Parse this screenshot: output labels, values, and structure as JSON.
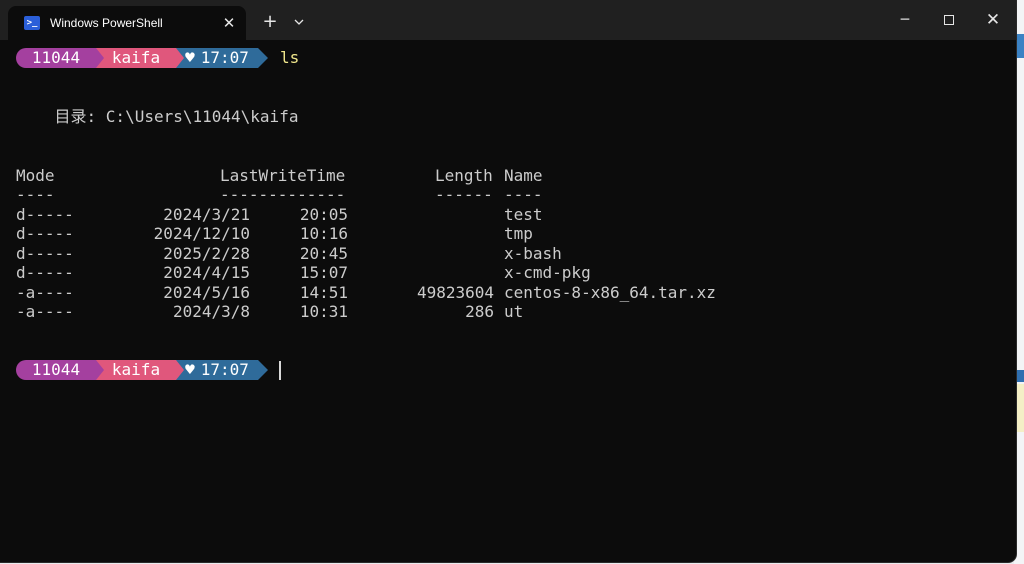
{
  "window": {
    "tab_title": "Windows PowerShell",
    "tab_icon": "powershell-icon",
    "new_tab_label": "+",
    "controls": [
      "minimize",
      "maximize",
      "close"
    ]
  },
  "prompt1": {
    "user": "11044",
    "dir": "kaifa",
    "heart": "♥",
    "time": "17:07",
    "command": "ls"
  },
  "directory_line": "    目录: C:\\Users\\11044\\kaifa",
  "listing": {
    "headers": {
      "mode": "Mode",
      "lastwrite": "LastWriteTime",
      "length": "Length",
      "name": "Name"
    },
    "underlines": {
      "mode": "----",
      "lastwrite": "-------------",
      "length": "------",
      "name": "----"
    },
    "rows": [
      {
        "mode": "d-----",
        "date": "2024/3/21",
        "time": "20:05",
        "length": "",
        "name": "test"
      },
      {
        "mode": "d-----",
        "date": "2024/12/10",
        "time": "10:16",
        "length": "",
        "name": "tmp"
      },
      {
        "mode": "d-----",
        "date": "2025/2/28",
        "time": "20:45",
        "length": "",
        "name": "x-bash"
      },
      {
        "mode": "d-----",
        "date": "2024/4/15",
        "time": "15:07",
        "length": "",
        "name": "x-cmd-pkg"
      },
      {
        "mode": "-a----",
        "date": "2024/5/16",
        "time": "14:51",
        "length": "49823604",
        "name": "centos-8-x86_64.tar.xz"
      },
      {
        "mode": "-a----",
        "date": "2024/3/8",
        "time": "10:31",
        "length": "286",
        "name": "ut"
      }
    ]
  },
  "prompt2": {
    "user": "11044",
    "dir": "kaifa",
    "heart": "♥",
    "time": "17:07"
  },
  "colors": {
    "user_segment": "#a4409f",
    "dir_segment": "#e0577c",
    "time_segment": "#2f6b9a",
    "terminal_bg": "#0c0c0c"
  }
}
